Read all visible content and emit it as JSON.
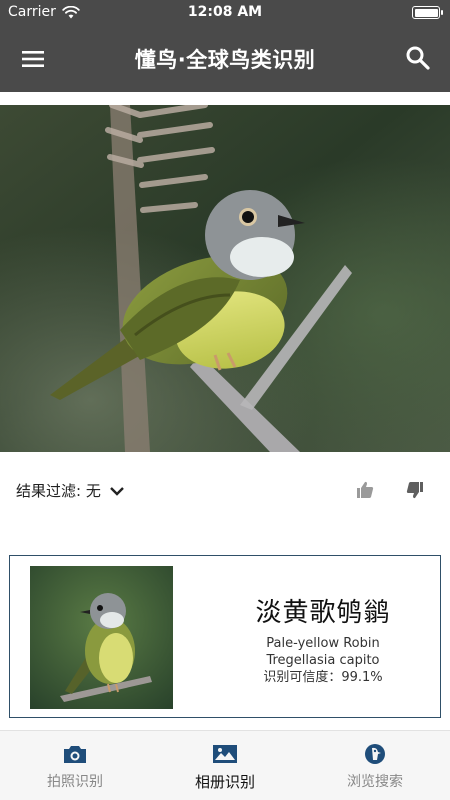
{
  "status_bar": {
    "carrier": "Carrier",
    "time": "12:08 AM"
  },
  "app_bar": {
    "title": "懂鸟·全球鸟类识别"
  },
  "filter": {
    "label": "结果过滤: 无"
  },
  "result": {
    "chinese_name": "淡黄歌鸲鹟",
    "english_name": "Pale-yellow Robin",
    "scientific_name": "Tregellasia capito",
    "confidence": "识别可信度：99.1%"
  },
  "bottom_nav": {
    "items": [
      {
        "label": "拍照识别",
        "icon": "camera-icon",
        "active": false
      },
      {
        "label": "相册识别",
        "icon": "image-icon",
        "active": true
      },
      {
        "label": "浏览搜索",
        "icon": "bird-search-icon",
        "active": false
      }
    ]
  },
  "colors": {
    "app_bar": "#4a4a4a",
    "card_border": "#2f4f68",
    "nav_icon": "#1f4d7a",
    "nav_inactive_text": "#888888"
  }
}
